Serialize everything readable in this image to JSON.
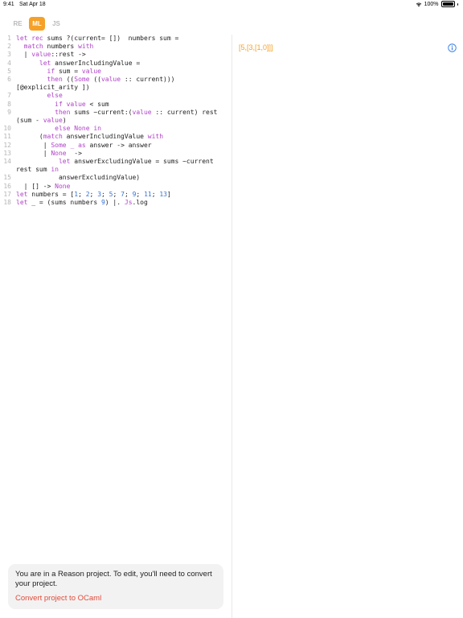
{
  "status_bar": {
    "time": "9:41",
    "date": "Sat Apr 18",
    "battery": "100%"
  },
  "tabs": [
    {
      "label": "RE",
      "active": false
    },
    {
      "label": "ML",
      "active": true
    },
    {
      "label": "JS",
      "active": false
    }
  ],
  "colors": {
    "accent": "#f5a127",
    "keyword": "#b043c9",
    "number": "#3473d6",
    "link": "#e14b3a"
  },
  "code": [
    {
      "n": "1",
      "tokens": [
        [
          "kw",
          "let rec"
        ],
        [
          "plain",
          " sums ?(current= [])  numbers sum ="
        ]
      ]
    },
    {
      "n": "2",
      "tokens": [
        [
          "kw",
          "  match"
        ],
        [
          "plain",
          " numbers "
        ],
        [
          "kw",
          "with"
        ]
      ]
    },
    {
      "n": "3",
      "tokens": [
        [
          "plain",
          "  | "
        ],
        [
          "kw",
          "value"
        ],
        [
          "plain",
          "::rest ->"
        ]
      ]
    },
    {
      "n": "4",
      "tokens": [
        [
          "kw",
          "      let"
        ],
        [
          "plain",
          " answerIncludingValue ="
        ]
      ]
    },
    {
      "n": "5",
      "tokens": [
        [
          "kw",
          "        if"
        ],
        [
          "plain",
          " sum = "
        ],
        [
          "kw",
          "value"
        ]
      ]
    },
    {
      "n": "6",
      "tokens": [
        [
          "kw",
          "        then"
        ],
        [
          "plain",
          " (("
        ],
        [
          "kw",
          "Some"
        ],
        [
          "plain",
          " (("
        ],
        [
          "kw",
          "value"
        ],
        [
          "plain",
          " :: current)))"
        ]
      ]
    },
    {
      "n": "",
      "tokens": [
        [
          "plain",
          "[@explicit_arity ])"
        ]
      ]
    },
    {
      "n": "7",
      "tokens": [
        [
          "kw",
          "        else"
        ]
      ]
    },
    {
      "n": "8",
      "tokens": [
        [
          "kw",
          "          if value"
        ],
        [
          "plain",
          " < sum"
        ]
      ]
    },
    {
      "n": "9",
      "tokens": [
        [
          "kw",
          "          then"
        ],
        [
          "plain",
          " sums ~current:("
        ],
        [
          "kw",
          "value"
        ],
        [
          "plain",
          " :: current) rest"
        ]
      ]
    },
    {
      "n": "",
      "tokens": [
        [
          "plain",
          "(sum - "
        ],
        [
          "kw",
          "value"
        ],
        [
          "plain",
          ")"
        ]
      ]
    },
    {
      "n": "10",
      "tokens": [
        [
          "kw",
          "          else None in"
        ]
      ]
    },
    {
      "n": "11",
      "tokens": [
        [
          "plain",
          "      ("
        ],
        [
          "kw",
          "match"
        ],
        [
          "plain",
          " answerIncludingValue "
        ],
        [
          "kw",
          "with"
        ]
      ]
    },
    {
      "n": "12",
      "tokens": [
        [
          "plain",
          "       | "
        ],
        [
          "kw",
          "Some _ as"
        ],
        [
          "plain",
          " answer -> answer"
        ]
      ]
    },
    {
      "n": "13",
      "tokens": [
        [
          "plain",
          "       | "
        ],
        [
          "kw",
          "None"
        ],
        [
          "plain",
          "  ->"
        ]
      ]
    },
    {
      "n": "14",
      "tokens": [
        [
          "kw",
          "           let"
        ],
        [
          "plain",
          " answerExcludingValue = sums ~current"
        ]
      ]
    },
    {
      "n": "",
      "tokens": [
        [
          "plain",
          "rest sum "
        ],
        [
          "kw",
          "in"
        ]
      ]
    },
    {
      "n": "15",
      "tokens": [
        [
          "plain",
          "           answerExcludingValue)"
        ]
      ]
    },
    {
      "n": "16",
      "tokens": [
        [
          "plain",
          "  | [] -> "
        ],
        [
          "kw",
          "None"
        ]
      ]
    },
    {
      "n": "17",
      "tokens": [
        [
          "kw",
          "let"
        ],
        [
          "plain",
          " numbers = ["
        ],
        [
          "num",
          "1"
        ],
        [
          "plain",
          "; "
        ],
        [
          "num",
          "2"
        ],
        [
          "plain",
          "; "
        ],
        [
          "num",
          "3"
        ],
        [
          "plain",
          "; "
        ],
        [
          "num",
          "5"
        ],
        [
          "plain",
          "; "
        ],
        [
          "num",
          "7"
        ],
        [
          "plain",
          "; "
        ],
        [
          "num",
          "9"
        ],
        [
          "plain",
          "; "
        ],
        [
          "num",
          "11"
        ],
        [
          "plain",
          "; "
        ],
        [
          "num",
          "13"
        ],
        [
          "plain",
          "]"
        ]
      ]
    },
    {
      "n": "18",
      "tokens": [
        [
          "kw",
          "let"
        ],
        [
          "plain",
          " _ = (sums numbers "
        ],
        [
          "num",
          "9"
        ],
        [
          "plain",
          ") |. "
        ],
        [
          "kw",
          "Js"
        ],
        [
          "plain",
          ".log"
        ]
      ]
    }
  ],
  "output": {
    "text": "[5,[3,[1,0]]]"
  },
  "notice": {
    "message": "You are in a Reason project. To edit, you'll need to convert your project.",
    "action": "Convert project to OCaml"
  }
}
